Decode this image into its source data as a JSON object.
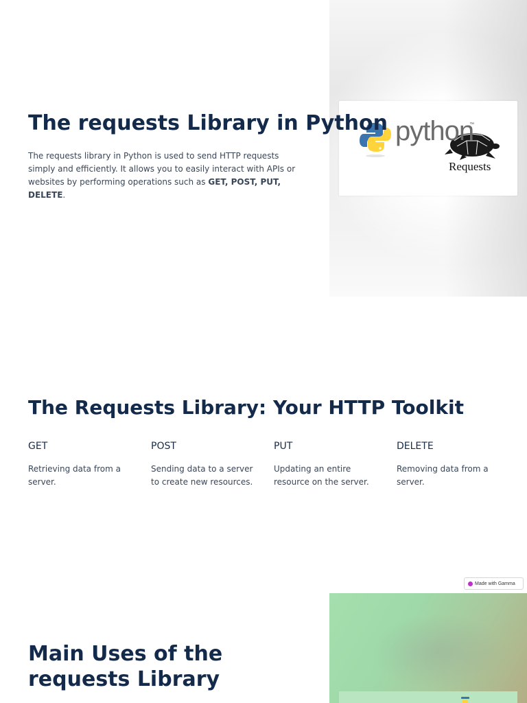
{
  "slide1": {
    "title": "The requests Library in Python",
    "body_prefix": "The requests library in Python is used to send HTTP requests simply and efficiently. It allows you to easily interact with APIs or websites by performing operations such as ",
    "body_bold": "GET, POST, PUT, DELETE",
    "body_suffix": ".",
    "logo": {
      "python_word": "python",
      "trademark": "™",
      "requests_word": "Requests"
    }
  },
  "slide2": {
    "title": "The Requests Library: Your HTTP Toolkit",
    "methods": [
      {
        "name": "GET",
        "description": "Retrieving data from a server."
      },
      {
        "name": "POST",
        "description": "Sending data to a server to create new resources."
      },
      {
        "name": "PUT",
        "description": "Updating an entire resource on the server."
      },
      {
        "name": "DELETE",
        "description": "Removing data from a server."
      }
    ]
  },
  "badge": {
    "label": "Made with Gamma"
  },
  "slide3": {
    "title": "Main Uses of the requests Library"
  },
  "colors": {
    "title": "#142a4a",
    "body": "#3a4657",
    "python_blue": "#3a75b0",
    "python_yellow": "#ffd43b",
    "green_panel": "#a6dfae"
  }
}
